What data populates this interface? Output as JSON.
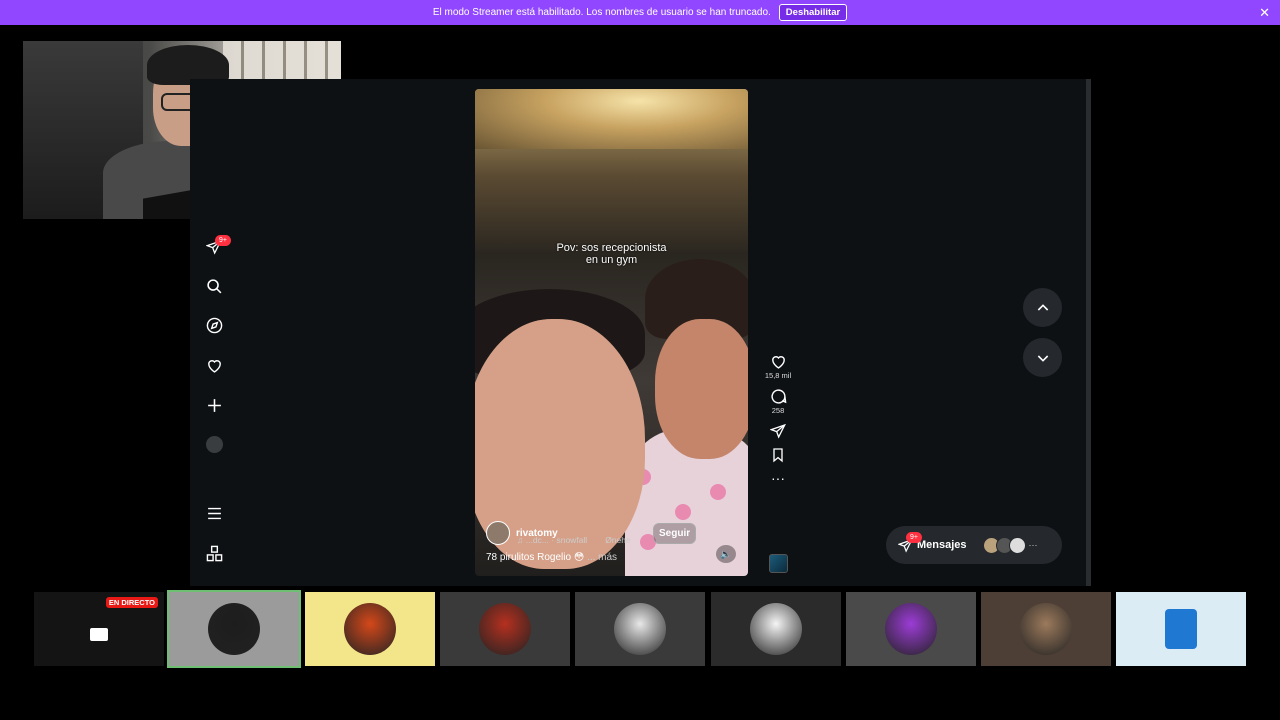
{
  "banner": {
    "message": "El modo Streamer está habilitado. Los nombres de usuario se han truncado.",
    "button_label": "Deshabilitar",
    "close_icon": "close-icon",
    "color": "#9147ff"
  },
  "sidebar": {
    "items": [
      {
        "name": "direct",
        "icon": "paper-plane-icon",
        "badge": "9+"
      },
      {
        "name": "search",
        "icon": "search-icon"
      },
      {
        "name": "explore",
        "icon": "compass-icon"
      },
      {
        "name": "notifications",
        "icon": "heart-icon"
      },
      {
        "name": "create",
        "icon": "plus-icon"
      },
      {
        "name": "profile",
        "icon": "avatar-icon"
      },
      {
        "name": "more",
        "icon": "menu-icon"
      },
      {
        "name": "also-from-meta",
        "icon": "apps-icon"
      }
    ]
  },
  "reel": {
    "caption_line1": "Pov: sos recepcionista",
    "caption_line2": "en un gym",
    "username": "rivatomy",
    "music_artist": "...dc...",
    "music_track": "snowfall",
    "music_extra": "Ønehe",
    "follow_label": "Seguir",
    "description": "78 pirulitos Rogelio 😳",
    "more_label": "... más",
    "likes": "15,8 mil",
    "comments": "258"
  },
  "messages": {
    "label": "Mensajes",
    "badge": "9+",
    "more": "···"
  },
  "strip": {
    "live_label": "EN DIRECTO",
    "tiles": [
      {
        "kind": "screen",
        "bg": "#141414"
      },
      {
        "kind": "avatar",
        "bg": "#9b9b9b",
        "avatar": "#1d1d1d",
        "selected": true
      },
      {
        "kind": "avatar",
        "bg": "#f2e58a",
        "avatar": "#d4481a"
      },
      {
        "kind": "avatar",
        "bg": "#3a3a3a",
        "avatar": "#b5301f"
      },
      {
        "kind": "avatar",
        "bg": "#3a3a3a",
        "avatar": "#e8e8e8"
      },
      {
        "kind": "avatar",
        "bg": "#2b2b2b",
        "avatar": "#f5f5f5"
      },
      {
        "kind": "avatar",
        "bg": "#4a4a4a",
        "avatar": "#9c3cd6"
      },
      {
        "kind": "avatar",
        "bg": "#4e3f36",
        "avatar": "#9c7a5c"
      },
      {
        "kind": "document",
        "bg": "#dcecf4",
        "avatar": "#1f78d1"
      }
    ]
  }
}
